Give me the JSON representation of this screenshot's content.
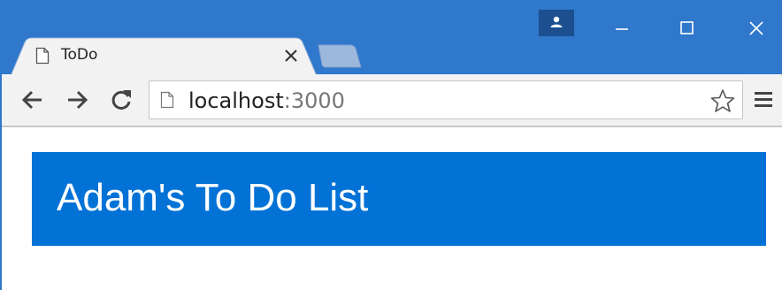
{
  "browser": {
    "tab": {
      "title": "ToDo",
      "icon": "document-icon",
      "close_icon": "close-icon"
    },
    "new_tab_icon": "new-tab-icon",
    "window_controls": {
      "profile_icon": "user-icon",
      "minimize_icon": "minimize-icon",
      "maximize_icon": "maximize-icon",
      "close_icon": "close-icon"
    },
    "toolbar": {
      "back_icon": "arrow-left-icon",
      "forward_icon": "arrow-right-icon",
      "reload_icon": "reload-icon",
      "address": {
        "host": "localhost",
        "port": ":3000",
        "page_icon": "page-icon"
      },
      "bookmark_icon": "star-icon",
      "menu_icon": "hamburger-menu-icon"
    },
    "colors": {
      "titlebar": "#2f78cc",
      "profile_box": "#1b4f8f",
      "toolbar": "#f2f2f2"
    }
  },
  "page": {
    "header": {
      "title": "Adam's To Do List",
      "background": "#0272d6",
      "text_color": "#ffffff"
    }
  }
}
